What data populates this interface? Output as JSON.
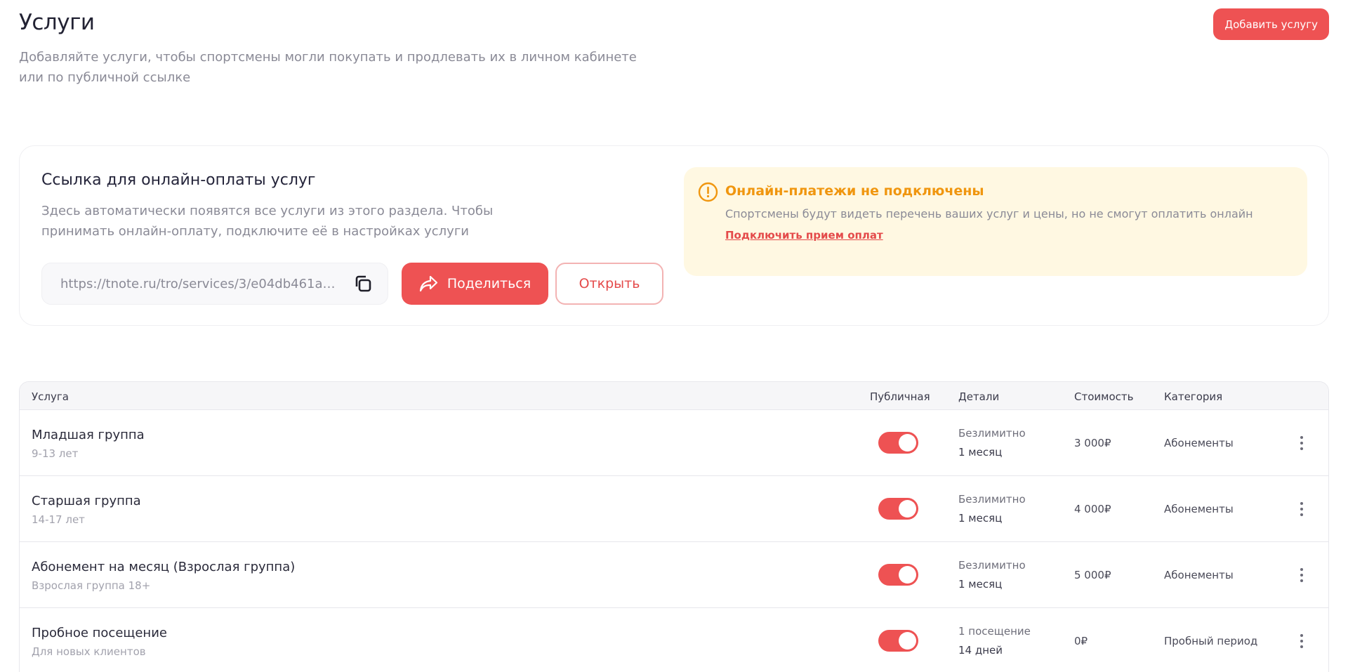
{
  "header": {
    "title": "Услуги",
    "subtitle": "Добавляйте услуги, чтобы спортсмены могли покупать и продлевать их в личном кабинете или по публичной ссылке",
    "add_button": "Добавить услугу"
  },
  "link_card": {
    "title": "Ссылка для онлайн-оплаты услуг",
    "description": "Здесь автоматически появятся все услуги из этого раздела. Чтобы принимать онлайн-оплату, подключите её в настройках услуги",
    "url": "https://tnote.ru/tro/services/3/e04db461a…",
    "share_label": "Поделиться",
    "open_label": "Открыть",
    "warning": {
      "title": "Онлайн-платежи не подключены",
      "text": "Спортсмены будут видеть перечень ваших услуг и цены, но не смогут оплатить онлайн",
      "link": "Подключить прием оплат"
    }
  },
  "table": {
    "columns": {
      "service": "Услуга",
      "public": "Публичная",
      "details": "Детали",
      "price": "Стоимость",
      "category": "Категория"
    },
    "rows": [
      {
        "name": "Младшая группа",
        "sub": "9-13 лет",
        "public": true,
        "detail1": "Безлимитно",
        "detail2": "1 месяц",
        "price": "3 000₽",
        "category": "Абонементы"
      },
      {
        "name": "Старшая группа",
        "sub": "14-17 лет",
        "public": true,
        "detail1": "Безлимитно",
        "detail2": "1 месяц",
        "price": "4 000₽",
        "category": "Абонементы"
      },
      {
        "name": "Абонемент на месяц (Взрослая группа)",
        "sub": "Взрослая группа 18+",
        "public": true,
        "detail1": "Безлимитно",
        "detail2": "1 месяц",
        "price": "5 000₽",
        "category": "Абонементы"
      },
      {
        "name": "Пробное посещение",
        "sub": "Для новых клиентов",
        "public": true,
        "detail1": "1 посещение",
        "detail2": "14 дней",
        "price": "0₽",
        "category": "Пробный период"
      }
    ]
  },
  "colors": {
    "accent": "#ee5253",
    "warning": "#f0960f",
    "warning_bg": "#fff8e2"
  }
}
